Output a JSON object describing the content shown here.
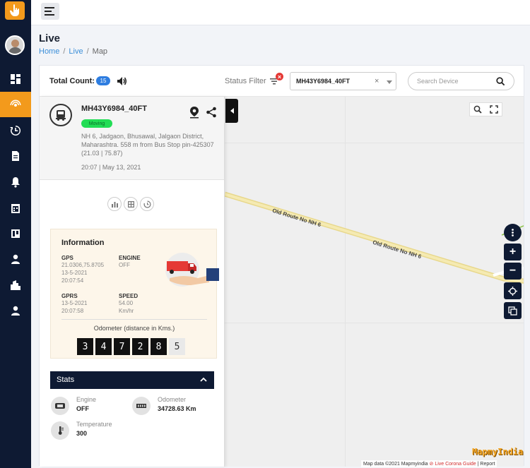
{
  "header": {
    "page_title": "Live"
  },
  "breadcrumb": {
    "home": "Home",
    "live": "Live",
    "current": "Map",
    "separator": "/"
  },
  "toolbar": {
    "total_count_label": "Total Count:",
    "total_count": "15",
    "status_filter_label": "Status Filter",
    "status_filter_badge": "×",
    "selected_device": "MH43Y6984_40FT",
    "clear_symbol": "×",
    "search_placeholder": "Search Device"
  },
  "vehicle": {
    "name": "MH43Y6984_40FT",
    "status": "Moving",
    "address": "NH 6, Jadgaon, Bhusawal, Jalgaon District, Maharashtra. 558 m from Bus Stop pin-425307 (21.03 | 75.87)",
    "timestamp": "20:07 | May 13, 2021"
  },
  "information": {
    "title": "Information",
    "gps_label": "GPS",
    "gps_coords": "21.0306,75.8705",
    "gps_date": "13-5-2021",
    "gps_time": "20:07:54",
    "engine_label": "ENGINE",
    "engine_value": "OFF",
    "gprs_label": "GPRS",
    "gprs_date": "13-5-2021",
    "gprs_time": "20:07:58",
    "speed_label": "SPEED",
    "speed_value": "54.00",
    "speed_unit": "Km/hr",
    "odometer_label": "Odometer (distance in Kms.)",
    "odometer_digits": [
      "3",
      "4",
      "7",
      "2",
      "8",
      "5"
    ]
  },
  "stats": {
    "title": "Stats",
    "engine_label": "Engine",
    "engine_value": "OFF",
    "odometer_label": "Odometer",
    "odometer_value": "34728.63 Km",
    "temperature_label": "Temperature",
    "temperature_value": "300"
  },
  "map": {
    "road_label_1": "Old Route No NH 6",
    "road_label_2": "Old Route No NH 6",
    "zoom_in": "+",
    "zoom_out": "−",
    "attribution_prefix": "Map data ©2021 Mapmyindia",
    "attribution_link": "Live Corona Guide",
    "attribution_report": "Report",
    "watermark": "MapmyIndia"
  },
  "colors": {
    "sidebar": "#0e1a33",
    "accent": "#f39a1c",
    "badge_blue": "#2e7de0",
    "moving_green": "#22dd55",
    "road": "#f3e6a2"
  },
  "icons": {
    "sidebar": [
      "dashboard-icon",
      "live-tracking-icon",
      "history-icon",
      "report-icon",
      "alert-icon",
      "calendar-icon",
      "board-icon",
      "user-icon",
      "building-icon",
      "account-icon"
    ]
  }
}
